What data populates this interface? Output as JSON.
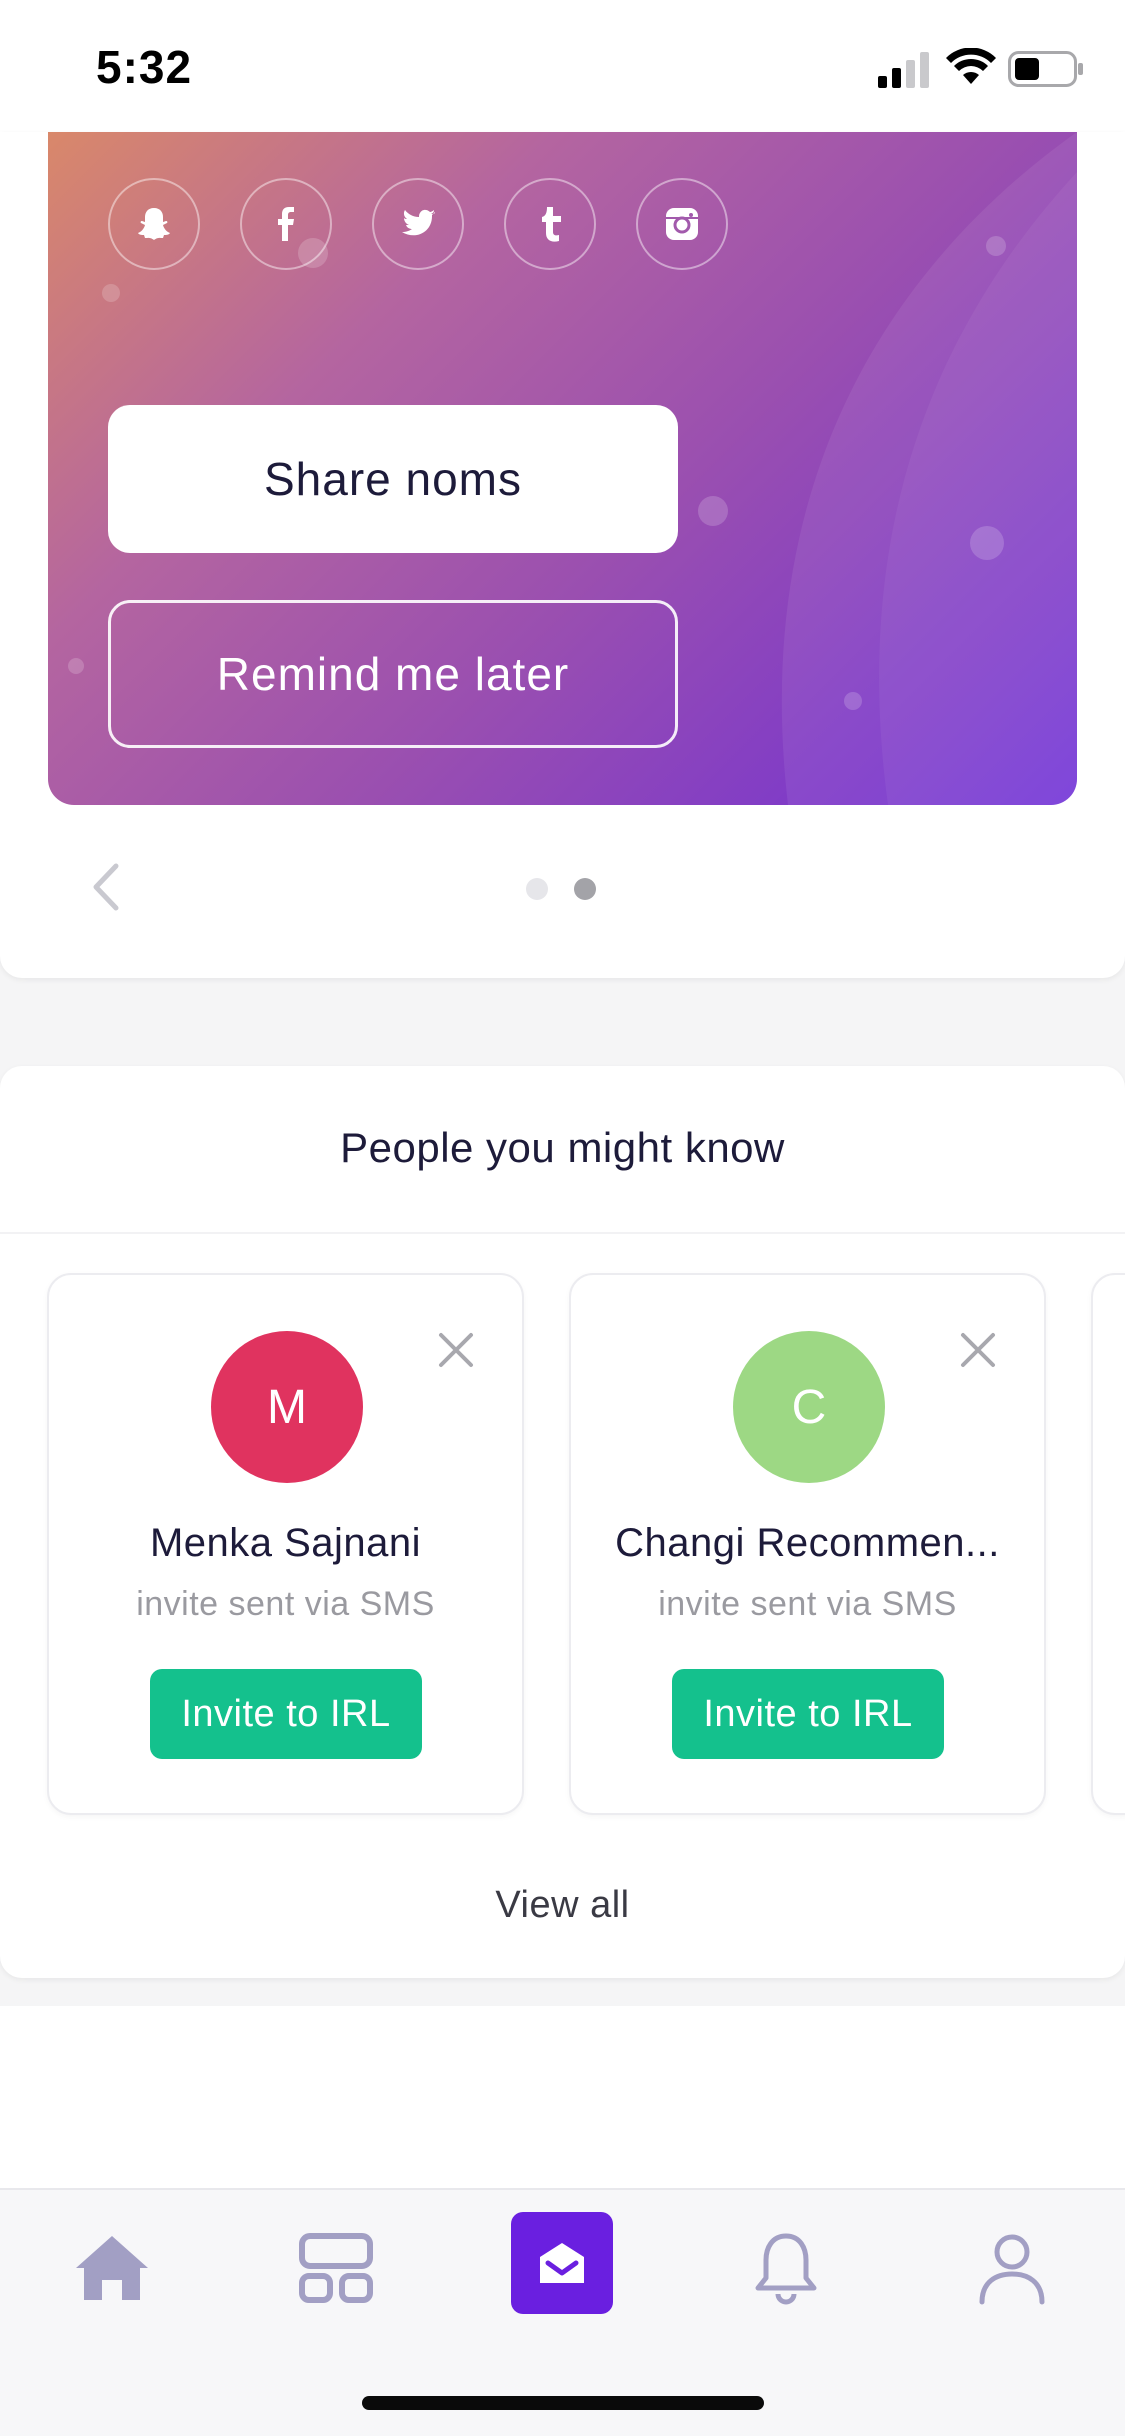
{
  "status_bar": {
    "time": "5:32"
  },
  "promo": {
    "social_icons": [
      "snapchat-icon",
      "facebook-icon",
      "twitter-icon",
      "tumblr-icon",
      "instagram-icon"
    ],
    "share_label": "Share noms",
    "remind_label": "Remind me later",
    "gradient_colors": [
      "#d9886a",
      "#b465a0",
      "#6f2fd6"
    ]
  },
  "carousel": {
    "page_count": 2,
    "active_index": 1
  },
  "people": {
    "title": "People you might know",
    "cards": [
      {
        "initial": "M",
        "name": "Menka Sajnani",
        "subtitle": "invite sent via SMS",
        "button": "Invite to IRL",
        "avatar_color": "#e0335f"
      },
      {
        "initial": "C",
        "name": "Changi Recommen...",
        "subtitle": "invite sent via SMS",
        "button": "Invite to IRL",
        "avatar_color": "#9dd884"
      }
    ],
    "view_all": "View all",
    "accent": "#14c18d"
  },
  "tab_bar": {
    "items": [
      "home-icon",
      "grid-icon",
      "inbox-icon",
      "bell-icon",
      "profile-icon"
    ],
    "active": "inbox-icon",
    "active_color": "#6a1fe0"
  }
}
